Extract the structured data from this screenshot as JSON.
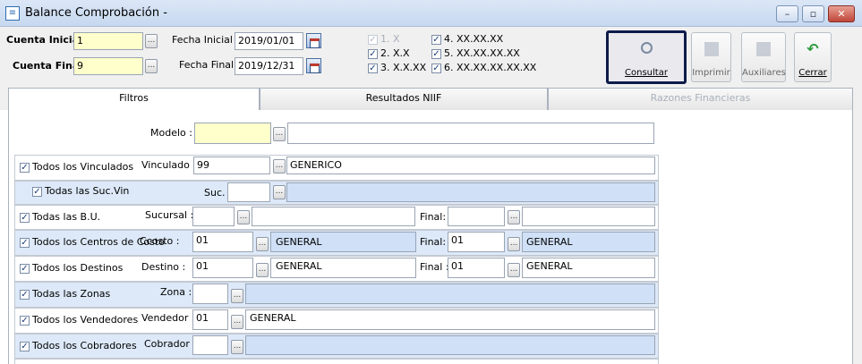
{
  "window": {
    "title": "Balance Comprobación -",
    "icon": "document-icon"
  },
  "params": {
    "cuenta_inicial_label": "Cuenta Inicial :",
    "cuenta_inicial": "1",
    "cuenta_final_label": "Cuenta Final :",
    "cuenta_final": "9",
    "fecha_inicial_label": "Fecha Inicial :",
    "fecha_inicial": "2019/01/01",
    "fecha_final_label": "Fecha Final :",
    "fecha_final": "2019/12/31"
  },
  "levels": [
    {
      "label": "1. X",
      "checked": true,
      "disabled": true
    },
    {
      "label": "2. X.X",
      "checked": true,
      "disabled": false
    },
    {
      "label": "3. X.X.XX",
      "checked": true,
      "disabled": false
    },
    {
      "label": "4. XX.XX.XX",
      "checked": true,
      "disabled": false
    },
    {
      "label": "5. XX.XX.XX.XX",
      "checked": true,
      "disabled": false
    },
    {
      "label": "6. XX.XX.XX.XX.XX",
      "checked": true,
      "disabled": false
    }
  ],
  "toolbar": {
    "consultar": "Consultar",
    "imprimir": "Imprimir",
    "auxiliares": "Auxiliares",
    "cerrar": "Cerrar"
  },
  "tabs": [
    "Filtros",
    "Resultados NIIF",
    "Razones Financieras"
  ],
  "filters": {
    "modelo_label": "Modelo :",
    "modelo_value": "",
    "vinculado": {
      "check": "Todos los Vinculados",
      "label": "Vinculado :",
      "code": "99",
      "name": "GENERICO"
    },
    "sucvin": {
      "check": "Todas las Suc.Vin",
      "label": "Suc."
    },
    "bu": {
      "check": "Todas las B.U.",
      "label": "Sucursal :",
      "final_label": "Final:"
    },
    "ccosto": {
      "check": "Todos los Centros de Costo",
      "label": "Ccosto :",
      "code": "01",
      "name": "GENERAL",
      "final_label": "Final:",
      "final_code": "01",
      "final_name": "GENERAL"
    },
    "destino": {
      "check": "Todos los Destinos",
      "label": "Destino :",
      "code": "01",
      "name": "GENERAL",
      "final_label": "Final :",
      "final_code": "01",
      "final_name": "GENERAL"
    },
    "zonas": {
      "check": "Todas las Zonas",
      "label": "Zona :"
    },
    "vendedor": {
      "check": "Todos los Vendedores",
      "label": "Vendedor :",
      "code": "01",
      "name": "GENERAL"
    },
    "cobrador": {
      "check": "Todos los Cobradores",
      "label": "Cobrador :"
    }
  },
  "colors": {
    "accent": "#0d1b4a",
    "row_blue": "#dde9f8",
    "field_yellow": "#ffffcc"
  }
}
